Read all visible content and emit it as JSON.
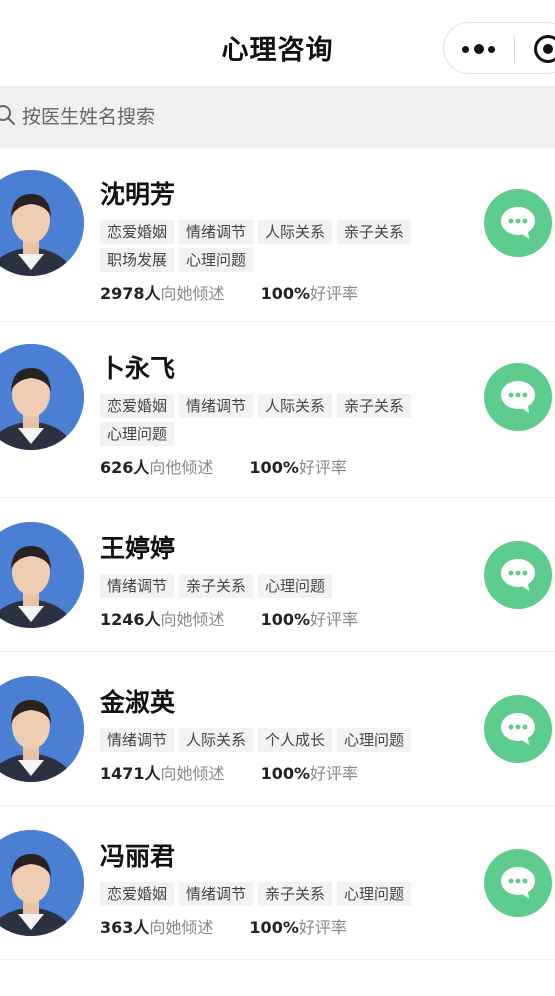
{
  "header": {
    "title": "心理咨询"
  },
  "search": {
    "placeholder": "按医生姓名搜索"
  },
  "colors": {
    "accent_green": "#5dcb8c",
    "avatar_blue": "#4a7fd3",
    "tag_bg": "#f2f2f2"
  },
  "doctors": [
    {
      "name": "沈明芳",
      "tags": [
        "恋爱婚姻",
        "情绪调节",
        "人际关系",
        "亲子关系",
        "职场发展",
        "心理问题"
      ],
      "count": "2978人",
      "listen_text": "向她倾述",
      "rating": "100%",
      "rating_text": "好评率"
    },
    {
      "name": "卜永飞",
      "tags": [
        "恋爱婚姻",
        "情绪调节",
        "人际关系",
        "亲子关系",
        "心理问题"
      ],
      "count": "626人",
      "listen_text": "向他倾述",
      "rating": "100%",
      "rating_text": "好评率"
    },
    {
      "name": "王婷婷",
      "tags": [
        "情绪调节",
        "亲子关系",
        "心理问题"
      ],
      "count": "1246人",
      "listen_text": "向她倾述",
      "rating": "100%",
      "rating_text": "好评率"
    },
    {
      "name": "金淑英",
      "tags": [
        "情绪调节",
        "人际关系",
        "个人成长",
        "心理问题"
      ],
      "count": "1471人",
      "listen_text": "向她倾述",
      "rating": "100%",
      "rating_text": "好评率"
    },
    {
      "name": "冯丽君",
      "tags": [
        "恋爱婚姻",
        "情绪调节",
        "亲子关系",
        "心理问题"
      ],
      "count": "363人",
      "listen_text": "向她倾述",
      "rating": "100%",
      "rating_text": "好评率"
    }
  ]
}
